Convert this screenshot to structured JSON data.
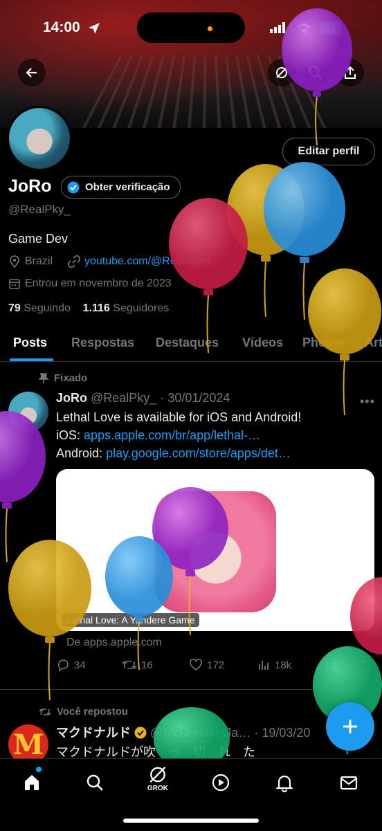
{
  "status_bar": {
    "time": "14:00",
    "battery": "66"
  },
  "profile": {
    "name": "JoRo",
    "verify_label": "Obter verificação",
    "handle": "@RealPky_",
    "bio": "Game Dev",
    "location": "Brazil",
    "link": "youtube.com/@Real-Joro",
    "joined": "Entrou em novembro de 2023",
    "following_count": "79",
    "following_label": "Seguindo",
    "followers_count": "1.116",
    "followers_label": "Seguidores",
    "edit_label": "Editar perfil"
  },
  "tabs": [
    "Posts",
    "Respostas",
    "Destaques",
    "Vídeos",
    "Photos",
    "Art"
  ],
  "pinned_tweet": {
    "pinned_label": "Fixado",
    "name": "JoRo",
    "handle": "@RealPky_",
    "date": "· 30/01/2024",
    "line1": "Lethal Love is available for iOS and Android!",
    "ios_prefix": "iOS:",
    "ios_link": "apps.apple.com/br/app/lethal-…",
    "android_prefix": "Android:",
    "android_link": "play.google.com/store/apps/det…",
    "card_title": "Lethal Love: A Yandere Game",
    "card_source": "De apps.apple.com",
    "replies": "34",
    "reposts": "16",
    "likes": "172",
    "views": "18k"
  },
  "repost_tweet": {
    "repost_label": "Você repostou",
    "name": "マクドナルド",
    "handle": "@McDonaldsJa…",
    "date": "· 19/03/20",
    "text": "マクドナルドが吹　っ　切　れ　た"
  },
  "bottom_nav": {
    "grok_label": "GROK"
  },
  "colors": {
    "accent": "#1d9bf0",
    "background": "#000000",
    "muted": "#71767b"
  }
}
